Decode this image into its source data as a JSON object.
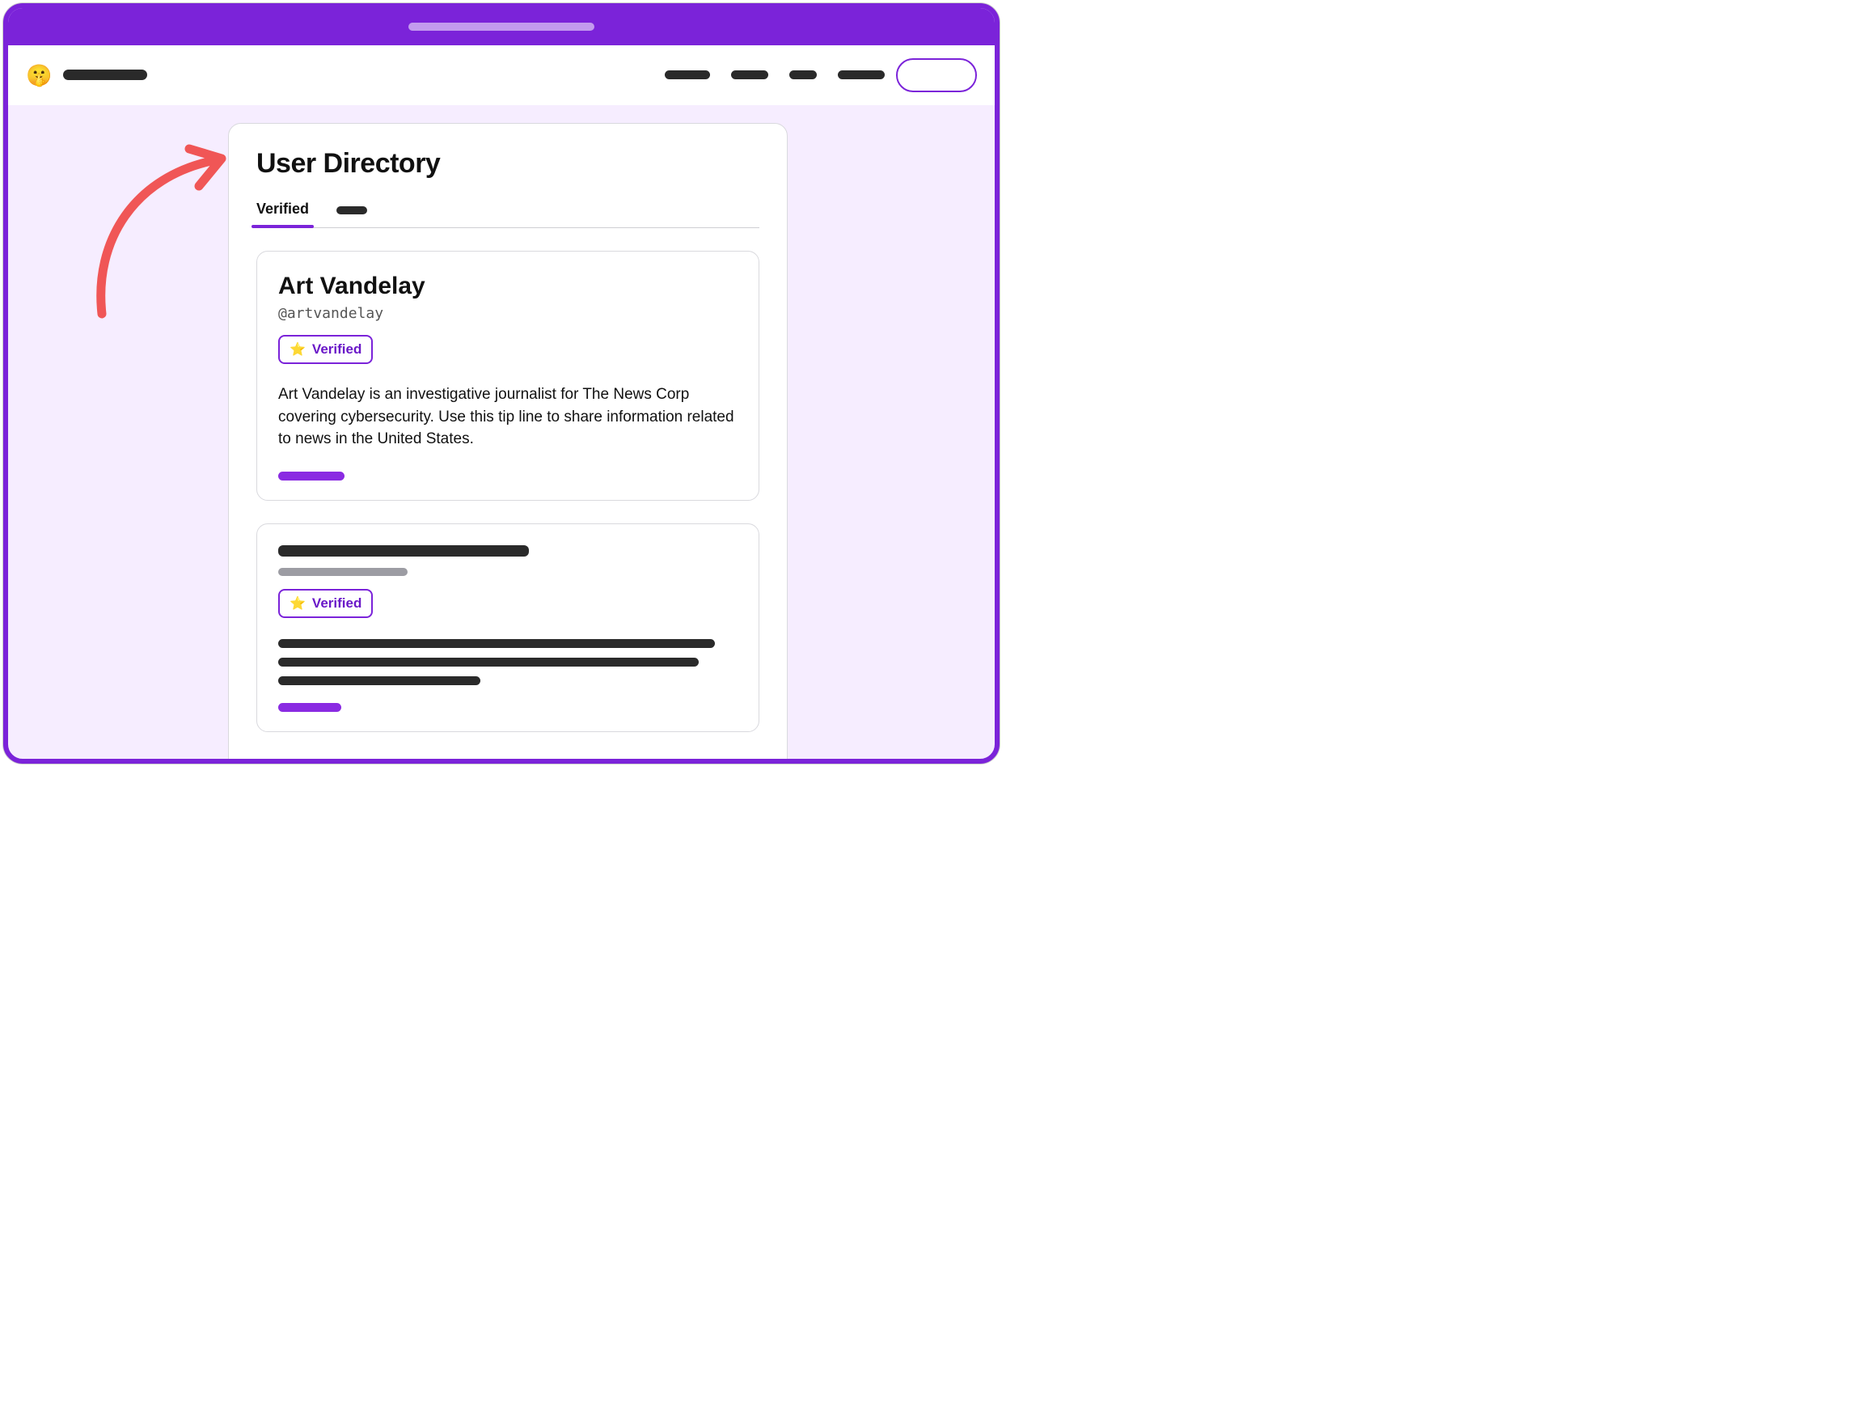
{
  "brand": {
    "emoji": "🤫"
  },
  "page": {
    "title": "User Directory"
  },
  "tabs": {
    "active": "Verified"
  },
  "badge_label": "Verified",
  "users": [
    {
      "name": "Art Vandelay",
      "handle": "@artvandelay",
      "bio": "Art Vandelay is an investigative journalist for The News Corp covering cybersecurity. Use this tip line to share information related to news in the United States."
    }
  ]
}
